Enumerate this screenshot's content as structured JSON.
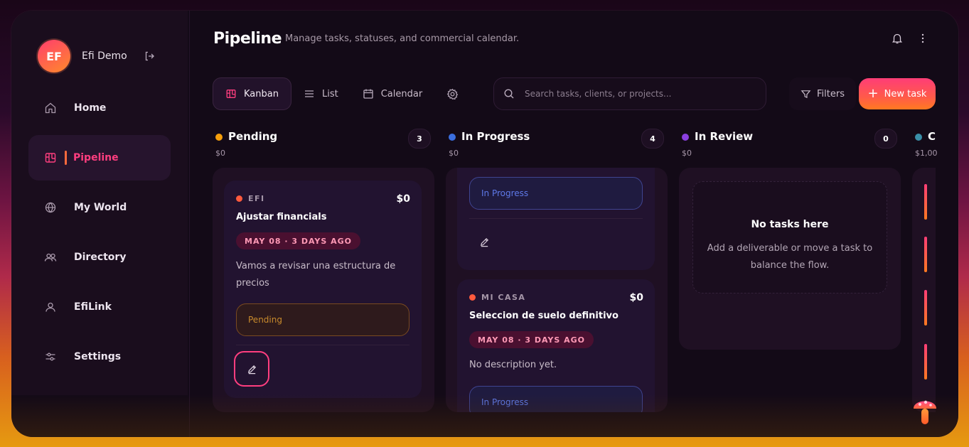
{
  "profile": {
    "initials": "EF",
    "name": "Efi Demo"
  },
  "nav": [
    {
      "label": "Home",
      "icon": "home-icon"
    },
    {
      "label": "Pipeline",
      "icon": "kanban-icon",
      "active": true
    },
    {
      "label": "My World",
      "icon": "globe-icon"
    },
    {
      "label": "Directory",
      "icon": "users-icon"
    },
    {
      "label": "EfiLink",
      "icon": "user-icon"
    },
    {
      "label": "Settings",
      "icon": "sliders-icon"
    }
  ],
  "header": {
    "title": "Pipeline",
    "subtitle": "Manage tasks, statuses, and commercial calendar."
  },
  "toolbar": {
    "views": [
      {
        "label": "Kanban",
        "icon": "kanban-icon",
        "active": true
      },
      {
        "label": "List",
        "icon": "list-icon"
      },
      {
        "label": "Calendar",
        "icon": "calendar-icon"
      }
    ],
    "settings_icon": "gear-icon",
    "search_placeholder": "Search tasks, clients, or projects...",
    "filters_label": "Filters",
    "new_task_label": "New task"
  },
  "columns": [
    {
      "title": "Pending",
      "color": "#f59e0b",
      "count": "3",
      "sum": "$0",
      "cards": [
        {
          "client": "EFI",
          "amount": "$0",
          "title": "Ajustar financials",
          "date": "MAY 08 · 3 DAYS AGO",
          "desc": "Vamos a revisar una estructura de precios",
          "status": "Pending"
        }
      ]
    },
    {
      "title": "In Progress",
      "color": "#3b6fe0",
      "count": "4",
      "sum": "$0",
      "cards": [
        {
          "status": "In Progress"
        },
        {
          "client": "MI CASA",
          "amount": "$0",
          "title": "Seleccion de suelo definitivo",
          "date": "MAY 08 · 3 DAYS AGO",
          "desc": "No description yet.",
          "status": "In Progress"
        }
      ]
    },
    {
      "title": "In Review",
      "color": "#8b3fe0",
      "count": "0",
      "sum": "$0",
      "empty_title": "No tasks here",
      "empty_desc": "Add a deliverable or move a task to balance the flow."
    },
    {
      "title": "C",
      "color": "#3a8fa8",
      "sum": "$1,00"
    }
  ],
  "colors": {
    "accent": "#ff3e7f",
    "accent_orange": "#ff7a20"
  }
}
